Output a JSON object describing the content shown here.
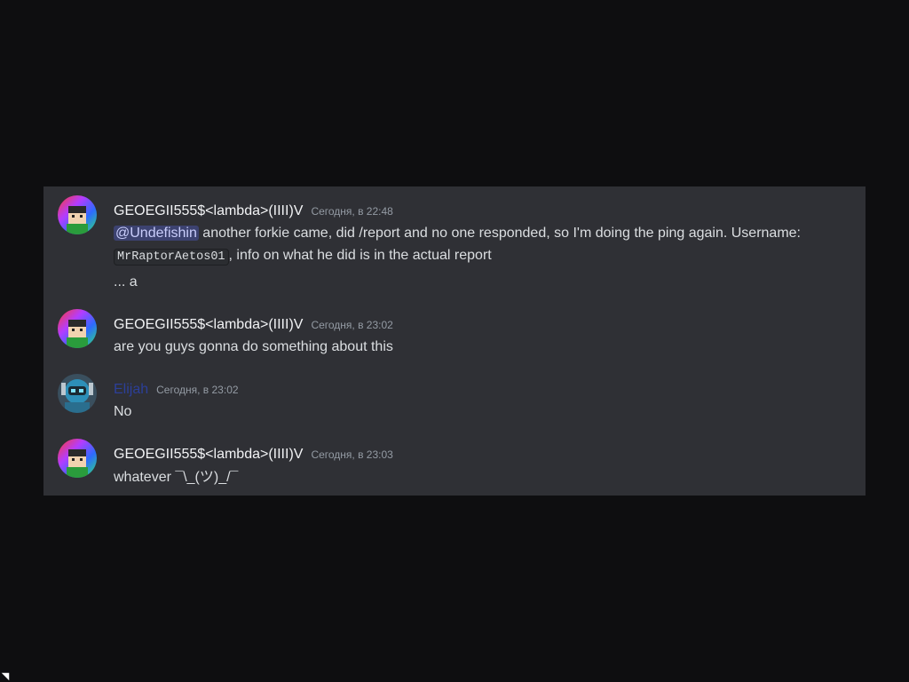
{
  "colors": {
    "background": "#0e0e10",
    "panel": "#2f3035",
    "username": "#f2f3f5",
    "username_elijah": "#2c3f99",
    "timestamp": "#949ba4",
    "text": "#dbdee1",
    "mention_bg": "#3c4270",
    "mention_text": "#c9cdfb"
  },
  "messages": [
    {
      "author": "GEOEGII555$<lambda>(IIII)V",
      "timestamp": "Сегодня, в 22:48",
      "avatar": "pixel-face-rainbow-avatar",
      "mention": "@Undefishin",
      "text_after_mention": " another forkie came, did /report and no one responded, so I'm doing the ping again. Username:",
      "code": "MrRaptorAetos01",
      "text_after_code": ", info on what he did is in the actual report",
      "extra_line": "... a"
    },
    {
      "author": "GEOEGII555$<lambda>(IIII)V",
      "timestamp": "Сегодня, в 23:02",
      "avatar": "pixel-face-rainbow-avatar",
      "text": "are you guys gonna do something about this"
    },
    {
      "author": "Elijah",
      "timestamp": "Сегодня, в 23:02",
      "avatar": "robot-blue-avatar",
      "text": "No"
    },
    {
      "author": "GEOEGII555$<lambda>(IIII)V",
      "timestamp": "Сегодня, в 23:03",
      "avatar": "pixel-face-rainbow-avatar",
      "text": "whatever ¯\\_(ツ)_/¯"
    }
  ]
}
